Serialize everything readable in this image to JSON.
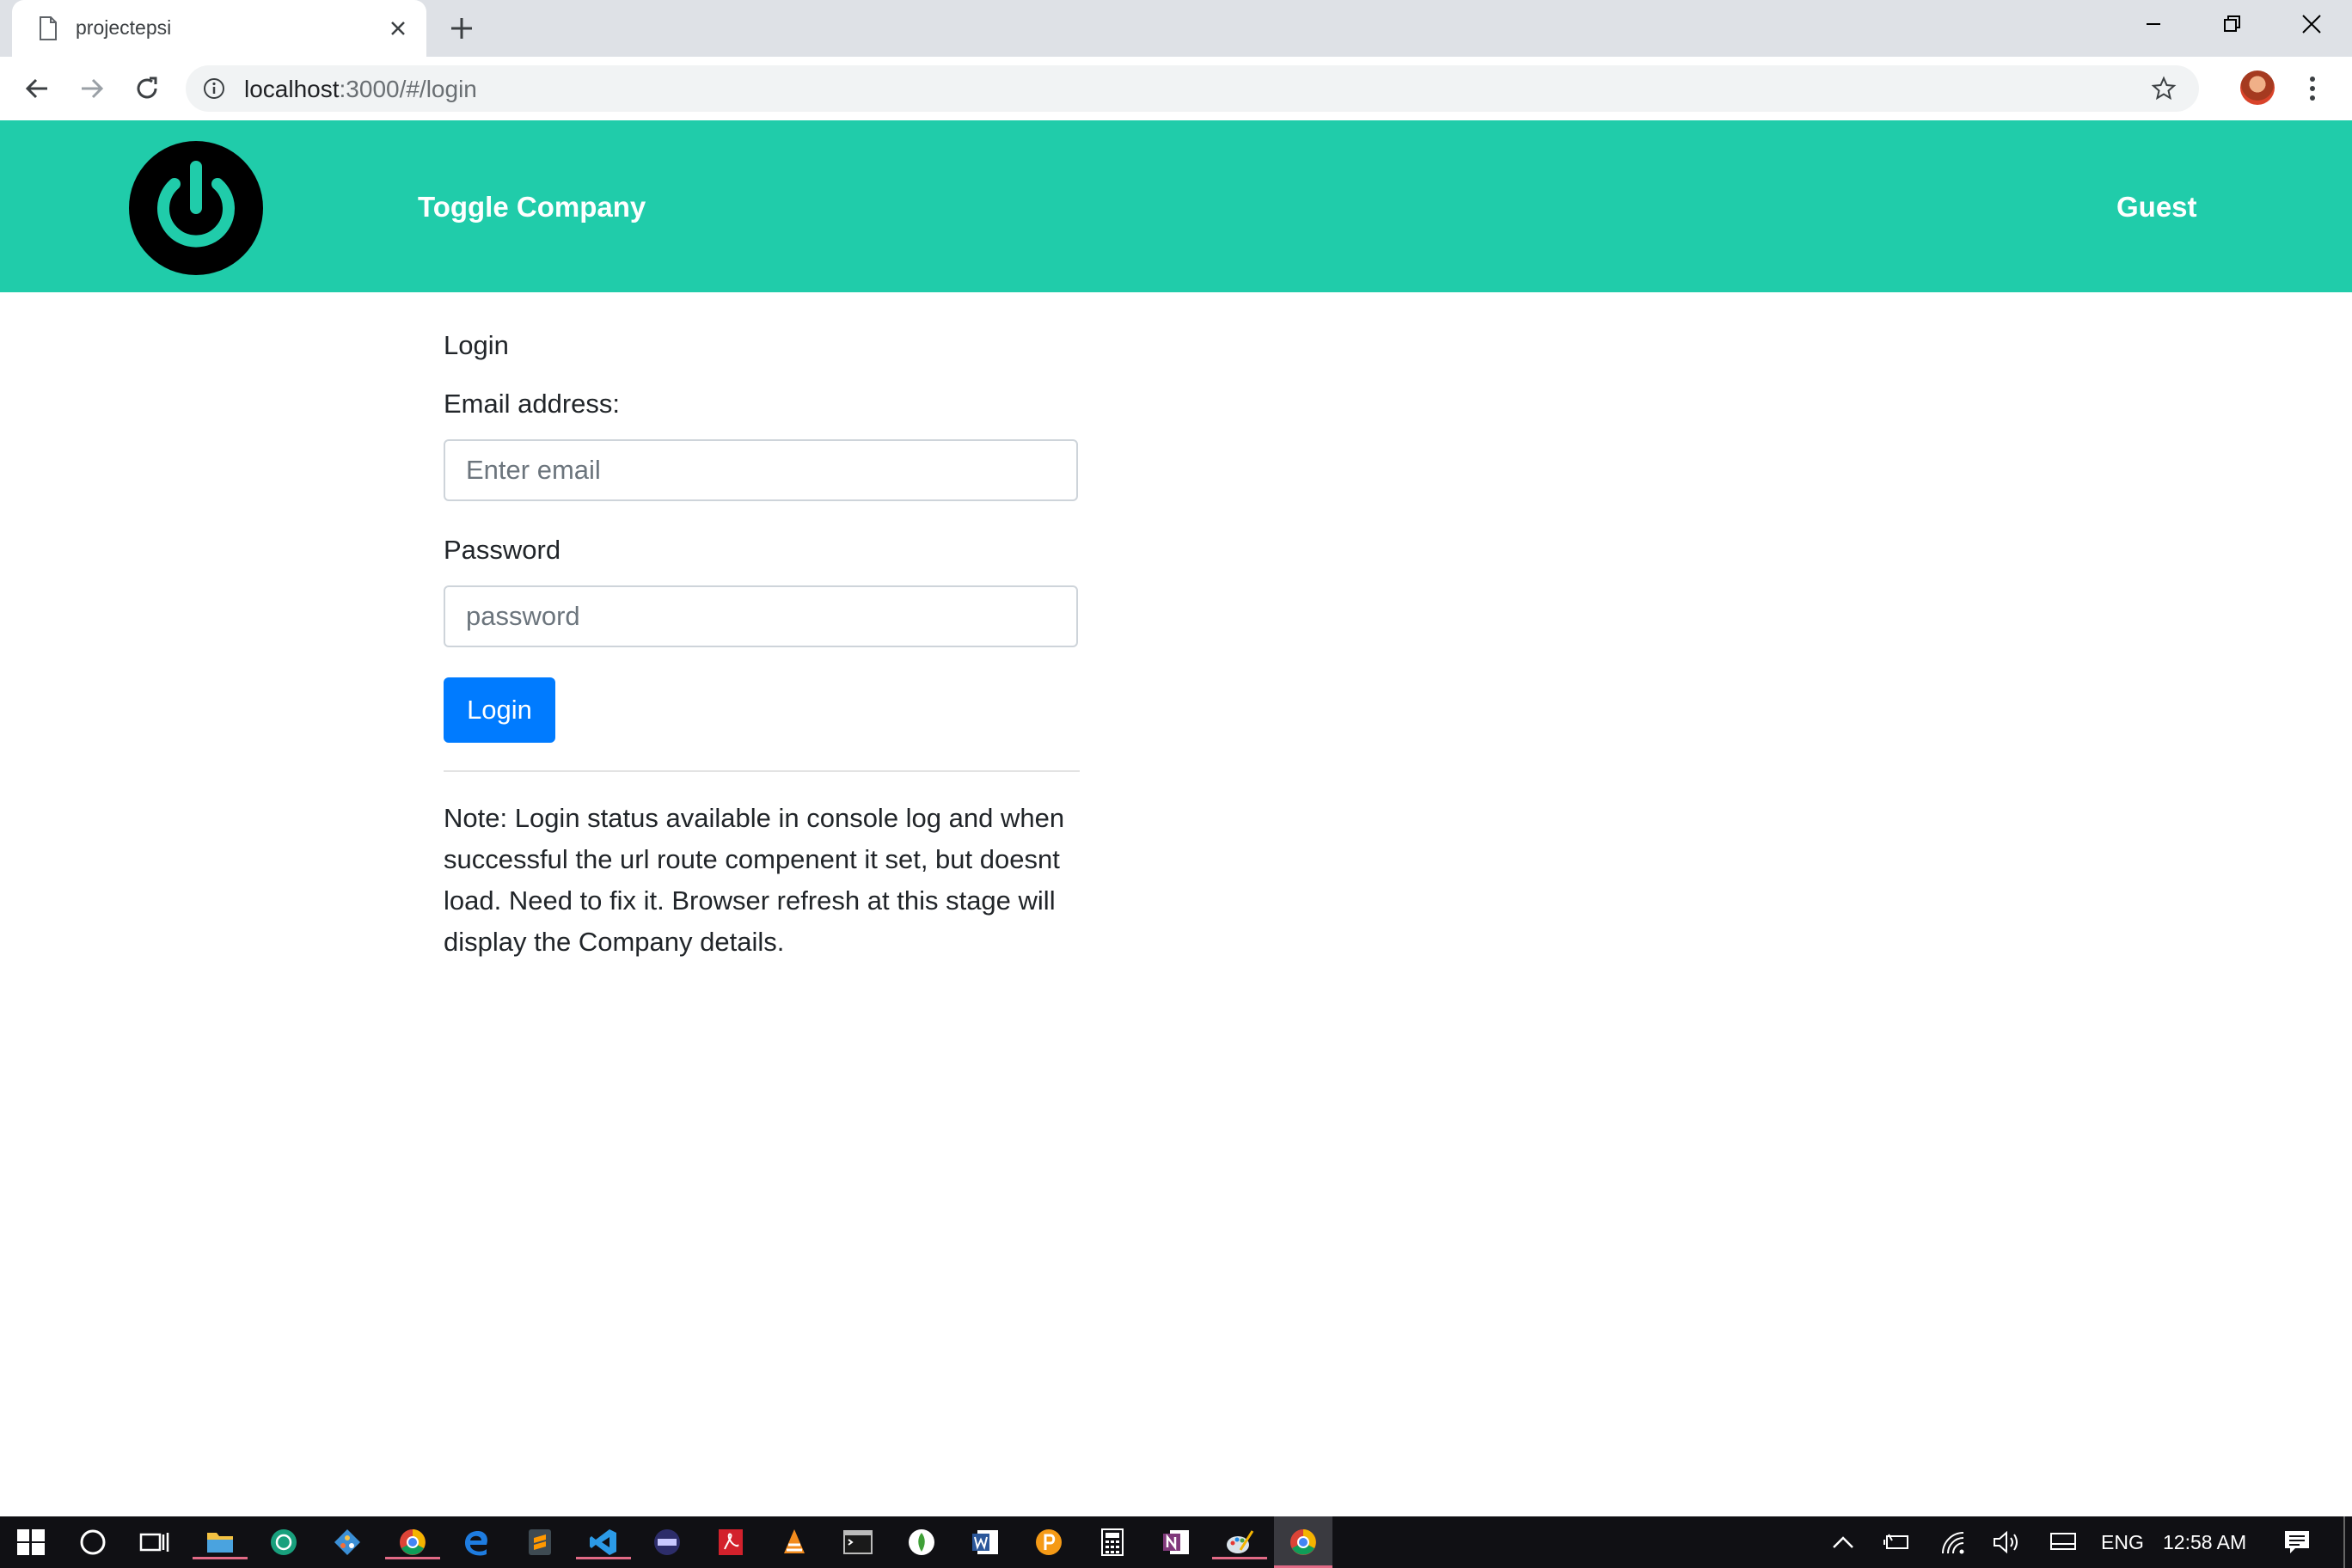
{
  "browser": {
    "tab_title": "projectepsi",
    "url_host": "localhost",
    "url_path": ":3000/#/login"
  },
  "navbar": {
    "brand": "Toggle Company",
    "user": "Guest",
    "accent_color": "#20ccaa"
  },
  "login_form": {
    "title": "Login",
    "email_label": "Email address:",
    "email_placeholder": "Enter email",
    "password_label": "Password",
    "password_placeholder": "password",
    "submit_label": "Login",
    "note": "Note: Login status available in console log and when successful the url route compenent it set, but doesnt load. Need to fix it. Browser refresh at this stage will display the Company details."
  },
  "taskbar": {
    "apps": [
      "start-icon",
      "cortana-icon",
      "task-view-icon",
      "file-explorer-icon",
      "chatgpt-icon",
      "git-icon",
      "chrome-icon",
      "edge-icon",
      "sublime-icon",
      "vscode-icon",
      "terminal-app-icon",
      "acrobat-icon",
      "vlc-icon",
      "cmd-icon",
      "mongodb-icon",
      "word-icon",
      "app-orange-icon",
      "calculator-icon",
      "onenote-icon",
      "paint-icon",
      "chrome-active-icon"
    ],
    "language": "ENG",
    "time": "12:58 AM"
  }
}
